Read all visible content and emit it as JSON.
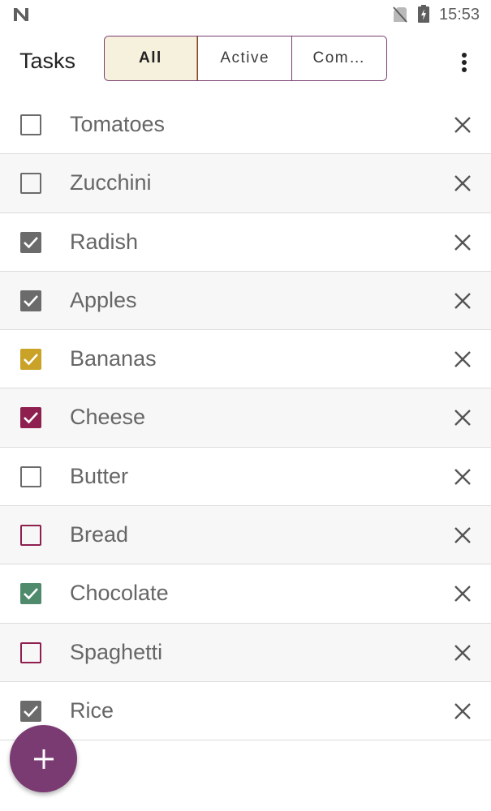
{
  "status_bar": {
    "time": "15:53",
    "icons": [
      "app-logo-icon",
      "no-sim-icon",
      "battery-charging-icon"
    ]
  },
  "toolbar": {
    "title": "Tasks",
    "filters": [
      {
        "label": "All",
        "selected": true
      },
      {
        "label": "Active",
        "selected": false
      },
      {
        "label": "Com…",
        "selected": false
      }
    ],
    "overflow_icon": "more-vert-icon"
  },
  "tasks": [
    {
      "label": "Tomatoes",
      "checked": false,
      "color": "#6b6b6b"
    },
    {
      "label": "Zucchini",
      "checked": false,
      "color": "#6b6b6b"
    },
    {
      "label": "Radish",
      "checked": true,
      "color": "#6b6b6b"
    },
    {
      "label": "Apples",
      "checked": true,
      "color": "#6b6b6b"
    },
    {
      "label": "Bananas",
      "checked": true,
      "color": "#c9a227"
    },
    {
      "label": "Cheese",
      "checked": true,
      "color": "#8e1f4f"
    },
    {
      "label": "Butter",
      "checked": false,
      "color": "#6b6b6b"
    },
    {
      "label": "Bread",
      "checked": false,
      "color": "#8e1f4f"
    },
    {
      "label": "Chocolate",
      "checked": true,
      "color": "#4f8a6c"
    },
    {
      "label": "Spaghetti",
      "checked": false,
      "color": "#8e1f4f"
    },
    {
      "label": "Rice",
      "checked": true,
      "color": "#6b6b6b"
    }
  ],
  "fab": {
    "icon": "add-icon",
    "color": "#7a3a72"
  },
  "colors": {
    "accent": "#7a3d72",
    "selected_filter_bg": "#f5f1dc",
    "selected_filter_border": "#c9a227"
  }
}
